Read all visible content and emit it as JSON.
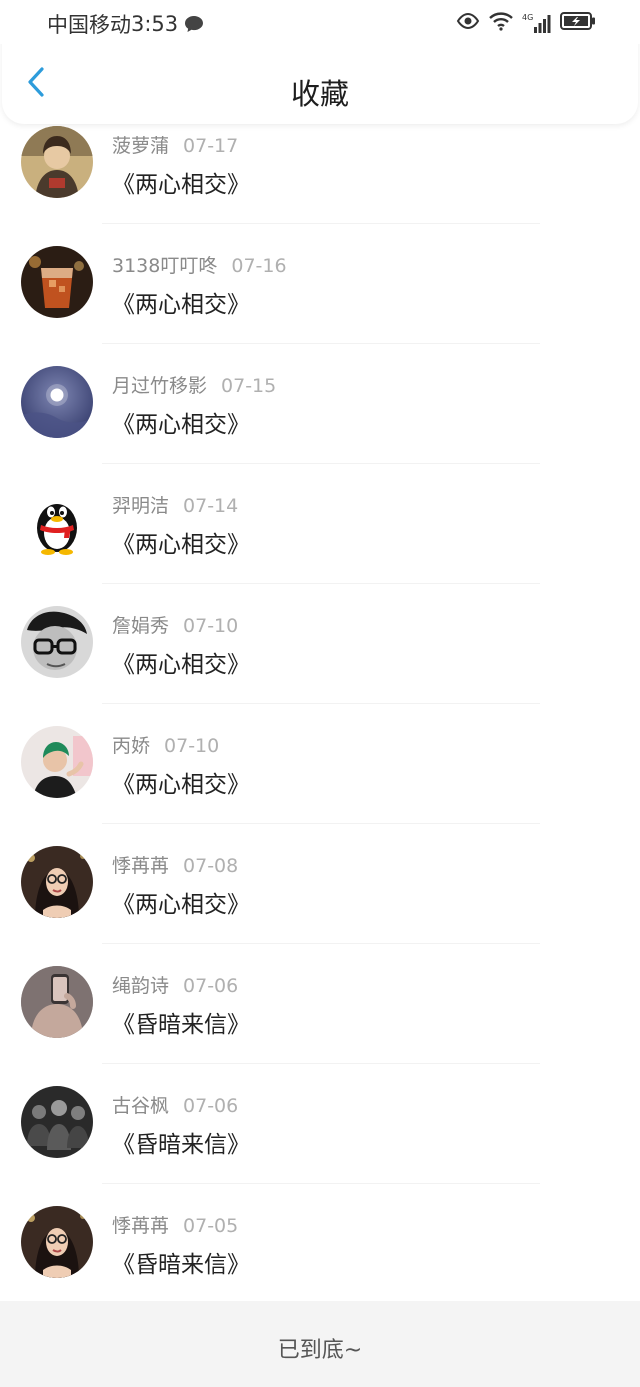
{
  "status_bar": {
    "carrier": "中国移动",
    "time": "3:53",
    "network": "4G"
  },
  "header": {
    "title": "收藏"
  },
  "colors": {
    "accent": "#2d9cdb",
    "username": "#8a8a8a",
    "date": "#b0b0b0",
    "title_text": "#222222"
  },
  "favorites": [
    {
      "username": "菠萝蒲",
      "date": "07-17",
      "title": "《两心相交》",
      "avatar": "painted-portrait"
    },
    {
      "username": "3138叮叮咚",
      "date": "07-16",
      "title": "《两心相交》",
      "avatar": "drink-glass"
    },
    {
      "username": "月过竹移影",
      "date": "07-15",
      "title": "《两心相交》",
      "avatar": "moon-night"
    },
    {
      "username": "羿明洁",
      "date": "07-14",
      "title": "《两心相交》",
      "avatar": "qq-penguin"
    },
    {
      "username": "詹娟秀",
      "date": "07-10",
      "title": "《两心相交》",
      "avatar": "bw-glasses-portrait"
    },
    {
      "username": "丙娇",
      "date": "07-10",
      "title": "《两心相交》",
      "avatar": "green-hair-portrait"
    },
    {
      "username": "悸苒苒",
      "date": "07-08",
      "title": "《两心相交》",
      "avatar": "girl-glasses-selfie"
    },
    {
      "username": "绳韵诗",
      "date": "07-06",
      "title": "《昏暗来信》",
      "avatar": "phone-selfie"
    },
    {
      "username": "古谷枫",
      "date": "07-06",
      "title": "《昏暗来信》",
      "avatar": "group-photo"
    },
    {
      "username": "悸苒苒",
      "date": "07-05",
      "title": "《昏暗来信》",
      "avatar": "girl-glasses-selfie"
    }
  ],
  "footer": {
    "end_text": "已到底~"
  }
}
